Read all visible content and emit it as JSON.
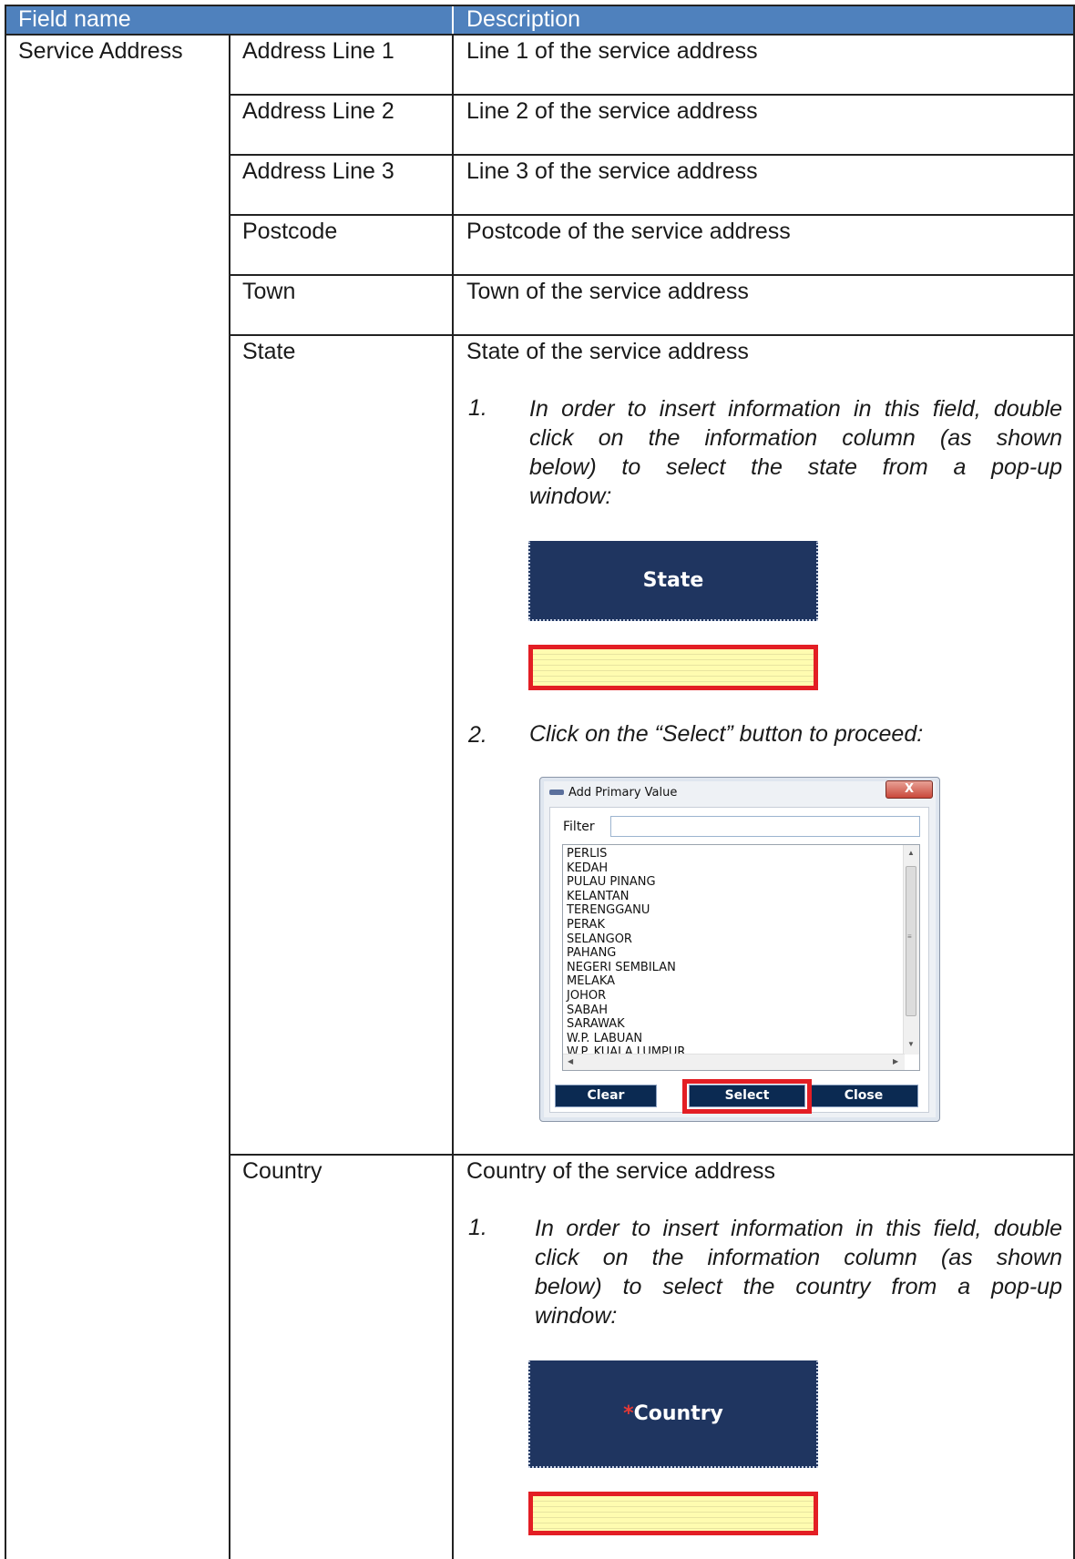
{
  "header": {
    "field_name": "Field name",
    "description": "Description"
  },
  "group_label": "Service Address",
  "rows": [
    {
      "field": "Address Line 1",
      "description": "Line 1 of the service address"
    },
    {
      "field": "Address Line 2",
      "description": "Line 2 of the service address"
    },
    {
      "field": "Address Line 3",
      "description": "Line 3 of the service address"
    },
    {
      "field": "Postcode",
      "description": "Postcode of the service address"
    },
    {
      "field": "Town",
      "description": "Town of the service address"
    },
    {
      "field": "State",
      "description": "State of the service address"
    },
    {
      "field": "Country",
      "description": "Country of the service address"
    }
  ],
  "state_steps": {
    "step1_number": "1.",
    "step1_lines": [
      "In order to insert information in this field, double",
      "click on the information column (as shown",
      "below) to select the state from a pop-up",
      "window:"
    ],
    "field_header_label": "State",
    "step2_number": "2.",
    "step2_text": "Click on the “Select” button to proceed:"
  },
  "dialog": {
    "title": "Add Primary Value",
    "close_glyph": "X",
    "filter_label": "Filter",
    "filter_value": "",
    "items": [
      "PERLIS",
      "KEDAH",
      "PULAU PINANG",
      "KELANTAN",
      "TERENGGANU",
      "PERAK",
      "SELANGOR",
      "PAHANG",
      "NEGERI SEMBILAN",
      "MELAKA",
      "JOHOR",
      "SABAH",
      "SARAWAK",
      "W.P. LABUAN",
      "W.P. KUALA LUMPUR"
    ],
    "buttons": {
      "clear": "Clear",
      "select": "Select",
      "close": "Close"
    }
  },
  "country_steps": {
    "step1_number": "1.",
    "step1_lines": [
      "In order to insert information in this field, double",
      "click on the information column (as shown",
      "below) to select the country from a pop-up",
      "window:"
    ],
    "required_mark": "*",
    "field_header_label": "Country"
  },
  "colors": {
    "header_bg": "#4f81bd",
    "field_header_bg": "#1f3560",
    "highlight_red": "#e31e24",
    "input_yellow": "#fffcb0",
    "dialog_button": "#0b2a52"
  }
}
